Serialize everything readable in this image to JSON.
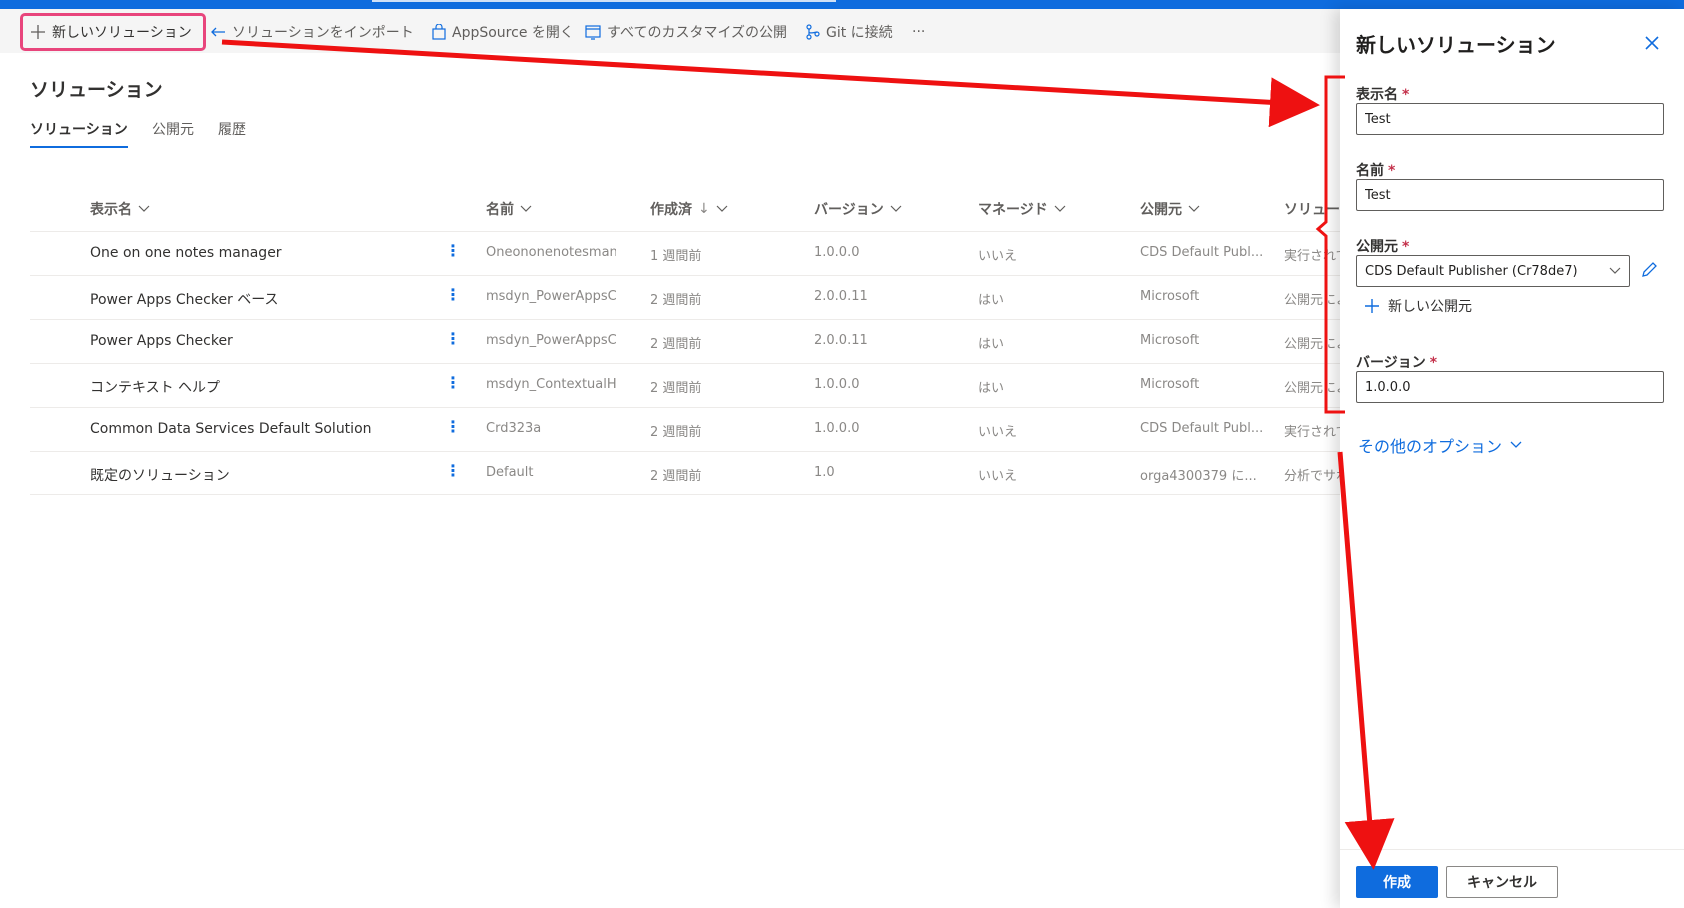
{
  "commandbar": {
    "new_solution": "新しいソリューション",
    "import_solution": "ソリューションをインポート",
    "open_appsource": "AppSource を開く",
    "publish_all": "すべてのカスタマイズの公開",
    "connect_git": "Git に接続",
    "more": "···"
  },
  "page": {
    "title": "ソリューション",
    "tabs": [
      "ソリューション",
      "公開元",
      "履歴"
    ]
  },
  "table": {
    "headers": {
      "display_name": "表示名",
      "name": "名前",
      "created": "作成済",
      "created_sort": "↓",
      "version": "バージョン",
      "managed": "マネージド",
      "publisher": "公開元",
      "solution": "ソリュー"
    },
    "rows": [
      {
        "display_name": "One on one notes manager",
        "name": "Oneononenotesman...",
        "created": "1 週間前",
        "version": "1.0.0.0",
        "managed": "いいえ",
        "publisher": "CDS Default Publ...",
        "status": "実行されて"
      },
      {
        "display_name": "Power Apps Checker ベース",
        "name": "msdyn_PowerAppsC...",
        "created": "2 週間前",
        "version": "2.0.0.11",
        "managed": "はい",
        "publisher": "Microsoft",
        "status": "公開元によ"
      },
      {
        "display_name": "Power Apps Checker",
        "name": "msdyn_PowerAppsC...",
        "created": "2 週間前",
        "version": "2.0.0.11",
        "managed": "はい",
        "publisher": "Microsoft",
        "status": "公開元によ"
      },
      {
        "display_name": "コンテキスト ヘルプ",
        "name": "msdyn_ContextualH...",
        "created": "2 週間前",
        "version": "1.0.0.0",
        "managed": "はい",
        "publisher": "Microsoft",
        "status": "公開元によ"
      },
      {
        "display_name": "Common Data Services Default Solution",
        "name": "Crd323a",
        "created": "2 週間前",
        "version": "1.0.0.0",
        "managed": "いいえ",
        "publisher": "CDS Default Publ...",
        "status": "実行されて"
      },
      {
        "display_name": "既定のソリューション",
        "name": "Default",
        "created": "2 週間前",
        "version": "1.0",
        "managed": "いいえ",
        "publisher": "orga4300379 に...",
        "status": "分析でサポ"
      }
    ],
    "row_more": "⋮"
  },
  "panel": {
    "title": "新しいソリューション",
    "required_mark": "*",
    "display_name_label": "表示名",
    "display_name_value": "Test",
    "name_label": "名前",
    "name_value": "Test",
    "publisher_label": "公開元",
    "publisher_value": "CDS Default Publisher (Cr78de7)",
    "new_publisher": "新しい公開元",
    "version_label": "バージョン",
    "version_value": "1.0.0.0",
    "more_options": "その他のオプション",
    "create_button": "作成",
    "cancel_button": "キャンセル"
  },
  "colors": {
    "accent": "#0f6cde",
    "highlight_border": "#e8457c",
    "annotation_red": "#ee1111"
  }
}
